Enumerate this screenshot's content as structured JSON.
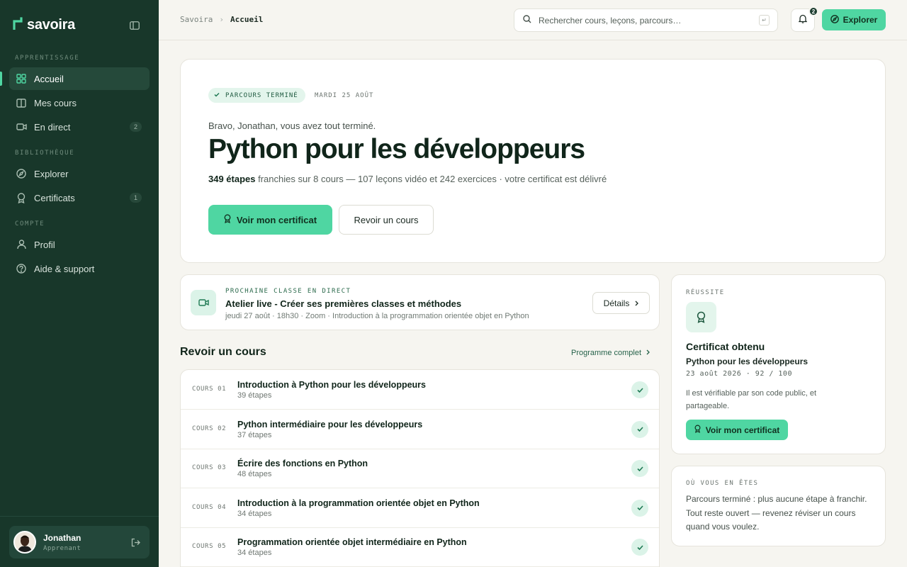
{
  "app": {
    "name": "savoira"
  },
  "sidebar": {
    "sections": [
      {
        "label": "APPRENTISSAGE"
      },
      {
        "label": "BIBLIOTHÈQUE"
      },
      {
        "label": "COMPTE"
      }
    ],
    "items": [
      {
        "label": "Accueil",
        "icon": "grid-icon",
        "active": true
      },
      {
        "label": "Mes cours",
        "icon": "book-icon"
      },
      {
        "label": "En direct",
        "icon": "video-icon",
        "count": "2"
      },
      {
        "label": "Explorer",
        "icon": "compass-icon"
      },
      {
        "label": "Certificats",
        "icon": "award-icon",
        "count": "1"
      },
      {
        "label": "Profil",
        "icon": "user-icon"
      },
      {
        "label": "Aide & support",
        "icon": "help-icon"
      }
    ],
    "user": {
      "name": "Jonathan",
      "role": "Apprenant"
    }
  },
  "topbar": {
    "breadcrumb": [
      "Savoira",
      "Accueil"
    ],
    "search_placeholder": "Rechercher cours, leçons, parcours…",
    "kbd_hint": "↵",
    "notifications_count": "2",
    "explore_label": "Explorer"
  },
  "hero": {
    "badge": "PARCOURS TERMINÉ",
    "date": "MARDI 25 AOÛT",
    "greeting": "Bravo, Jonathan, vous avez tout terminé.",
    "title": "Python pour les développeurs",
    "stats_strong": "349 étapes",
    "stats_rest": " franchies sur 8 cours — 107 leçons vidéo et 242 exercices · votre certificat est délivré",
    "primary_label": "Voir mon certificat",
    "secondary_label": "Revoir un cours"
  },
  "live": {
    "label": "PROCHAINE CLASSE EN DIRECT",
    "title": "Atelier live - Créer ses premières classes et méthodes",
    "meta": "jeudi 27 août · 18h30 · Zoom · Introduction à la programmation orientée objet en Python",
    "details_label": "Détails"
  },
  "courses": {
    "heading": "Revoir un cours",
    "program_link": "Programme complet",
    "items": [
      {
        "num": "COURS 01",
        "name": "Introduction à Python pour les développeurs",
        "steps": "39 étapes"
      },
      {
        "num": "COURS 02",
        "name": "Python intermédiaire pour les développeurs",
        "steps": "37 étapes"
      },
      {
        "num": "COURS 03",
        "name": "Écrire des fonctions en Python",
        "steps": "48 étapes"
      },
      {
        "num": "COURS 04",
        "name": "Introduction à la programmation orientée objet en Python",
        "steps": "34 étapes"
      },
      {
        "num": "COURS 05",
        "name": "Programmation orientée objet intermédiaire en Python",
        "steps": "34 étapes"
      }
    ]
  },
  "certificate": {
    "label": "RÉUSSITE",
    "title": "Certificat obtenu",
    "course": "Python pour les développeurs",
    "meta": "23 août 2026 · 92 / 100",
    "description": "Il est vérifiable par son code public, et partageable.",
    "button_label": "Voir mon certificat"
  },
  "status": {
    "label": "OÙ VOUS EN ÊTES",
    "text": "Parcours terminé : plus aucune étape à franchir. Tout reste ouvert — revenez réviser un cours quand vous voulez."
  },
  "colors": {
    "sidebar_bg": "#18372a",
    "accent": "#4fd6a2",
    "page_bg": "#f6f5f0"
  }
}
